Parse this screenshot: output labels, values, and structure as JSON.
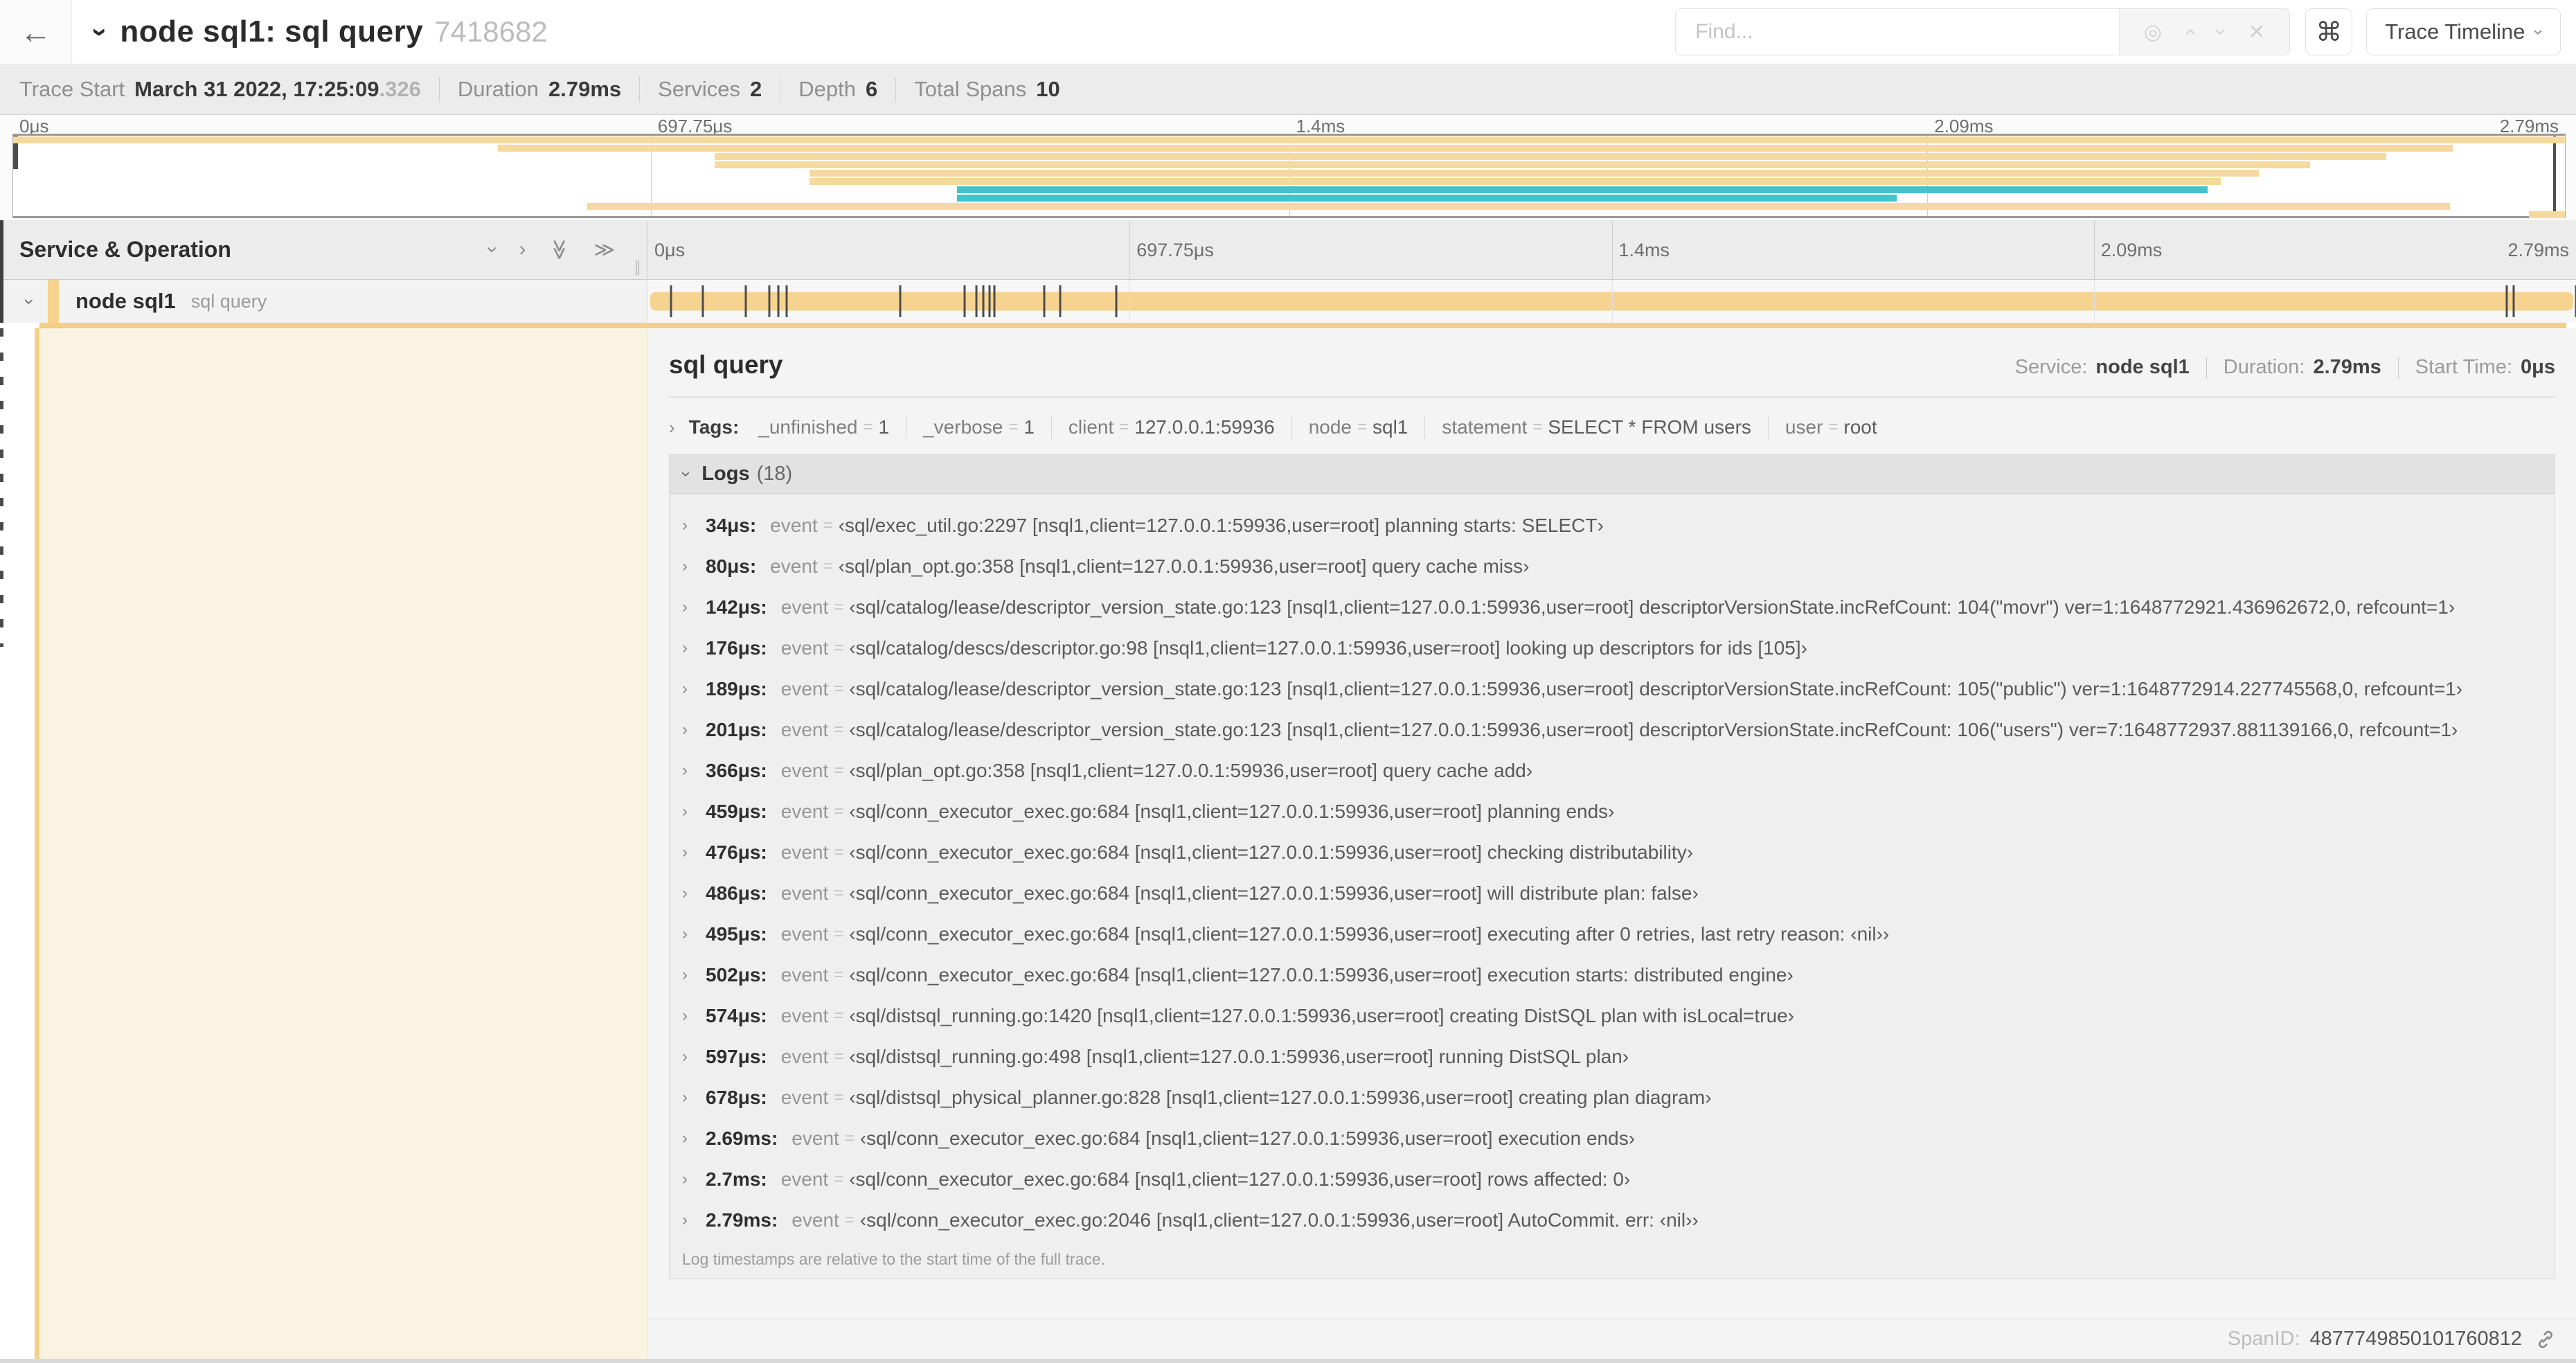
{
  "colors": {
    "span_tan": "#F6D38F",
    "mini_tan": "#F6D99E",
    "teal": "#41C5CB",
    "cream": "#FBF3E1",
    "strip_tan": "#F3CF86"
  },
  "icons": {
    "back": "←",
    "collapse": "›",
    "target": "◎",
    "prev": "›",
    "next": "›",
    "clear": "✕",
    "command": "⌘",
    "dropdown": "›",
    "chevron": "›",
    "double_chevron": "≫",
    "resizer": "∥"
  },
  "header": {
    "title": "node sql1: sql query",
    "trace_id": "7418682",
    "find_placeholder": "Find...",
    "view_dropdown": "Trace Timeline"
  },
  "summary": {
    "items": [
      {
        "label": "Trace Start",
        "value": "March 31 2022, 17:25:09",
        "value_suffix": ".326"
      },
      {
        "label": "Duration",
        "value": "2.79ms"
      },
      {
        "label": "Services",
        "value": "2"
      },
      {
        "label": "Depth",
        "value": "6"
      },
      {
        "label": "Total Spans",
        "value": "10"
      }
    ]
  },
  "minimap": {
    "ticks": [
      "0μs",
      "697.75μs",
      "1.4ms",
      "2.09ms",
      "2.79ms"
    ],
    "bars": [
      {
        "row": 0,
        "start": 0,
        "end": 100,
        "color": "#F6D99E"
      },
      {
        "row": 1,
        "start": 19,
        "end": 95.6,
        "color": "#F6D99E"
      },
      {
        "row": 2,
        "start": 27.5,
        "end": 93,
        "color": "#F6D99E"
      },
      {
        "row": 3,
        "start": 27.5,
        "end": 90,
        "color": "#F6D99E"
      },
      {
        "row": 4,
        "start": 31.2,
        "end": 88,
        "color": "#F6D99E"
      },
      {
        "row": 5,
        "start": 31.2,
        "end": 86.5,
        "color": "#F6D99E"
      },
      {
        "row": 6,
        "start": 37,
        "end": 86,
        "color": "#41C5CB"
      },
      {
        "row": 7,
        "start": 37,
        "end": 73.8,
        "color": "#41C5CB"
      },
      {
        "row": 8,
        "start": 22.5,
        "end": 95.5,
        "color": "#F6D99E"
      },
      {
        "row": 9,
        "start": 98.6,
        "end": 100,
        "color": "#F6D99E"
      }
    ]
  },
  "timeline": {
    "left_header": "Service & Operation",
    "ticks": [
      "0μs",
      "697.75μs",
      "1.4ms",
      "2.09ms",
      "2.79ms"
    ],
    "total_us": 2790,
    "span_row": {
      "service": "node sql1",
      "operation": "sql query",
      "start_pct": 0.15,
      "end_pct": 99.85,
      "color": "#F6D38F"
    }
  },
  "detail": {
    "operation": "sql query",
    "overview": [
      {
        "label": "Service:",
        "value": "node sql1"
      },
      {
        "label": "Duration:",
        "value": "2.79ms"
      },
      {
        "label": "Start Time:",
        "value": "0μs"
      }
    ],
    "tags": {
      "label": "Tags:",
      "items": [
        {
          "key": "_unfinished",
          "value": "1"
        },
        {
          "key": "_verbose",
          "value": "1"
        },
        {
          "key": "client",
          "value": "127.0.0.1:59936"
        },
        {
          "key": "node",
          "value": "sql1"
        },
        {
          "key": "statement",
          "value": "SELECT * FROM users"
        },
        {
          "key": "user",
          "value": "root"
        }
      ]
    },
    "logs": {
      "label": "Logs",
      "count": "(18)",
      "entries": [
        {
          "time": "34μs",
          "time_us": 34,
          "field": "event",
          "value": "sql/exec_util.go:2297 [nsql1,client=127.0.0.1:59936,user=root] planning starts: SELECT"
        },
        {
          "time": "80μs",
          "time_us": 80,
          "field": "event",
          "value": "sql/plan_opt.go:358 [nsql1,client=127.0.0.1:59936,user=root] query cache miss"
        },
        {
          "time": "142μs",
          "time_us": 142,
          "field": "event",
          "value": "sql/catalog/lease/descriptor_version_state.go:123 [nsql1,client=127.0.0.1:59936,user=root] descriptorVersionState.incRefCount: 104(\"movr\") ver=1:1648772921.436962672,0, refcount=1"
        },
        {
          "time": "176μs",
          "time_us": 176,
          "field": "event",
          "value": "sql/catalog/descs/descriptor.go:98 [nsql1,client=127.0.0.1:59936,user=root] looking up descriptors for ids [105]"
        },
        {
          "time": "189μs",
          "time_us": 189,
          "field": "event",
          "value": "sql/catalog/lease/descriptor_version_state.go:123 [nsql1,client=127.0.0.1:59936,user=root] descriptorVersionState.incRefCount: 105(\"public\") ver=1:1648772914.227745568,0, refcount=1"
        },
        {
          "time": "201μs",
          "time_us": 201,
          "field": "event",
          "value": "sql/catalog/lease/descriptor_version_state.go:123 [nsql1,client=127.0.0.1:59936,user=root] descriptorVersionState.incRefCount: 106(\"users\") ver=7:1648772937.881139166,0, refcount=1"
        },
        {
          "time": "366μs",
          "time_us": 366,
          "field": "event",
          "value": "sql/plan_opt.go:358 [nsql1,client=127.0.0.1:59936,user=root] query cache add"
        },
        {
          "time": "459μs",
          "time_us": 459,
          "field": "event",
          "value": "sql/conn_executor_exec.go:684 [nsql1,client=127.0.0.1:59936,user=root] planning ends"
        },
        {
          "time": "476μs",
          "time_us": 476,
          "field": "event",
          "value": "sql/conn_executor_exec.go:684 [nsql1,client=127.0.0.1:59936,user=root] checking distributability"
        },
        {
          "time": "486μs",
          "time_us": 486,
          "field": "event",
          "value": "sql/conn_executor_exec.go:684 [nsql1,client=127.0.0.1:59936,user=root] will distribute plan: false"
        },
        {
          "time": "495μs",
          "time_us": 495,
          "field": "event",
          "value": "sql/conn_executor_exec.go:684 [nsql1,client=127.0.0.1:59936,user=root] executing after 0 retries, last retry reason: ‹nil›"
        },
        {
          "time": "502μs",
          "time_us": 502,
          "field": "event",
          "value": "sql/conn_executor_exec.go:684 [nsql1,client=127.0.0.1:59936,user=root] execution starts: distributed engine"
        },
        {
          "time": "574μs",
          "time_us": 574,
          "field": "event",
          "value": "sql/distsql_running.go:1420 [nsql1,client=127.0.0.1:59936,user=root] creating DistSQL plan with isLocal=true"
        },
        {
          "time": "597μs",
          "time_us": 597,
          "field": "event",
          "value": "sql/distsql_running.go:498 [nsql1,client=127.0.0.1:59936,user=root] running DistSQL plan"
        },
        {
          "time": "678μs",
          "time_us": 678,
          "field": "event",
          "value": "sql/distsql_physical_planner.go:828 [nsql1,client=127.0.0.1:59936,user=root] creating plan diagram"
        },
        {
          "time": "2.69ms",
          "time_us": 2690,
          "field": "event",
          "value": "sql/conn_executor_exec.go:684 [nsql1,client=127.0.0.1:59936,user=root] execution ends"
        },
        {
          "time": "2.7ms",
          "time_us": 2700,
          "field": "event",
          "value": "sql/conn_executor_exec.go:684 [nsql1,client=127.0.0.1:59936,user=root] rows affected: 0"
        },
        {
          "time": "2.79ms",
          "time_us": 2790,
          "field": "event",
          "value": "sql/conn_executor_exec.go:2046 [nsql1,client=127.0.0.1:59936,user=root] AutoCommit. err: ‹nil›"
        }
      ],
      "footnote": "Log timestamps are relative to the start time of the full trace."
    },
    "footer": {
      "label": "SpanID:",
      "value": "4877749850101760812"
    }
  }
}
